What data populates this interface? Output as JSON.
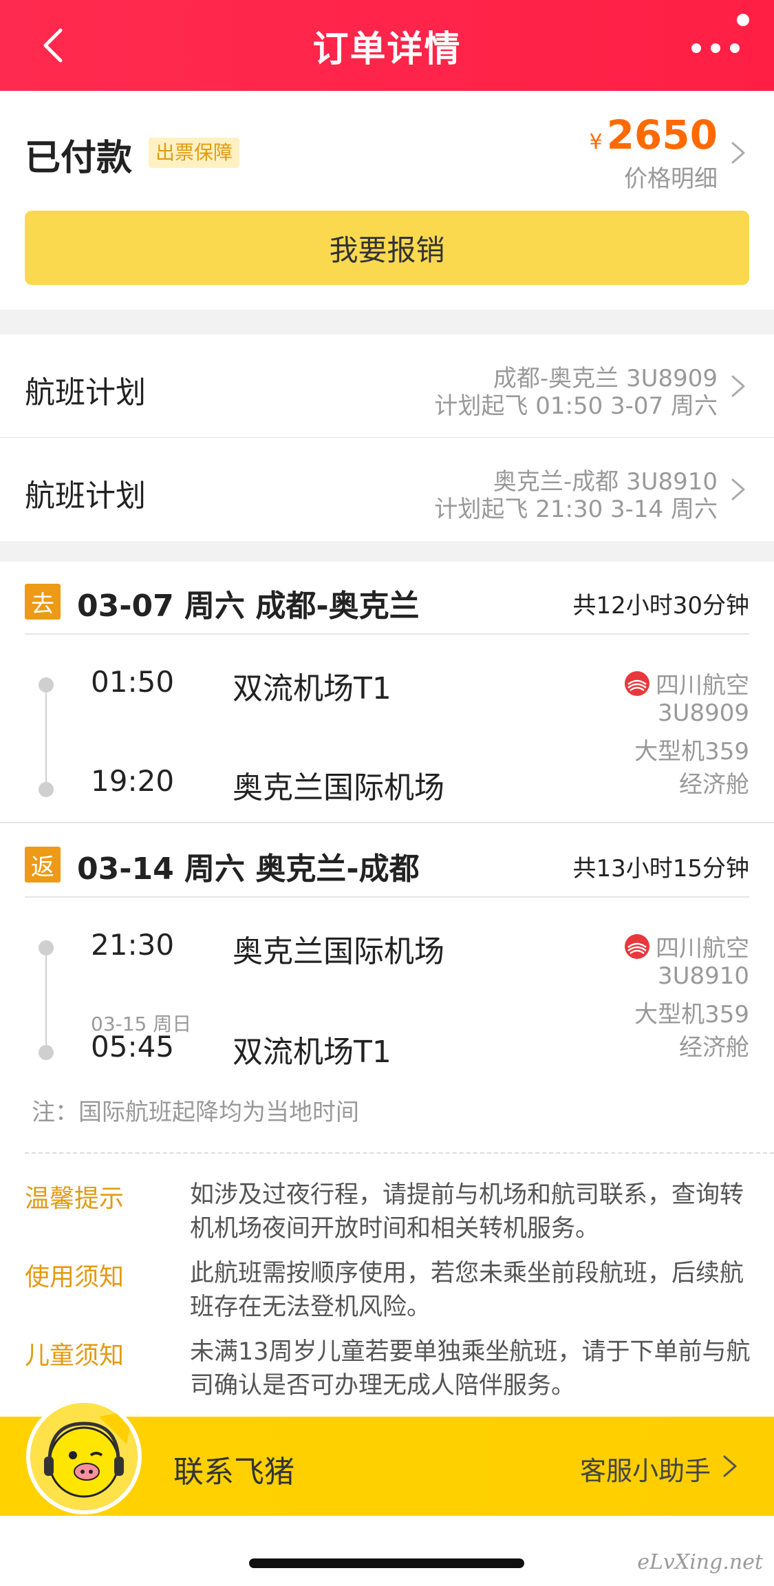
{
  "header": {
    "title": "订单详情"
  },
  "payment": {
    "status": "已付款",
    "badge": "出票保障",
    "currency": "¥",
    "amount": "2650",
    "detail_label": "价格明细",
    "reimburse_button": "我要报销"
  },
  "plans": [
    {
      "label": "航班计划",
      "route": "成都-奥克兰 3U8909",
      "departure": "计划起飞 01:50 3-07 周六"
    },
    {
      "label": "航班计划",
      "route": "奥克兰-成都 3U8910",
      "departure": "计划起飞 21:30 3-14 周六"
    }
  ],
  "segments": [
    {
      "tag": "去",
      "heading": "03-07 周六 成都-奥克兰",
      "duration": "共12小时30分钟",
      "dep_time": "01:50",
      "dep_airport": "双流机场T1",
      "arr_note": "",
      "arr_time": "19:20",
      "arr_airport": "奥克兰国际机场",
      "airline": "四川航空",
      "flight_no": "3U8909",
      "aircraft": "大型机359",
      "cabin": "经济舱"
    },
    {
      "tag": "返",
      "heading": "03-14 周六 奥克兰-成都",
      "duration": "共13小时15分钟",
      "dep_time": "21:30",
      "dep_airport": "奥克兰国际机场",
      "arr_note": "03-15 周日",
      "arr_time": "05:45",
      "arr_airport": "双流机场T1",
      "airline": "四川航空",
      "flight_no": "3U8910",
      "aircraft": "大型机359",
      "cabin": "经济舱"
    }
  ],
  "note": "注：国际航班起降均为当地时间",
  "tips": [
    {
      "key": "温馨提示",
      "text": "如涉及过夜行程，请提前与机场和航司联系，查询转机机场夜间开放时间和相关转机服务。"
    },
    {
      "key": "使用须知",
      "text": "此航班需按顺序使用，若您未乘坐前段航班，后续航班存在无法登机风险。"
    },
    {
      "key": "儿童须知",
      "text": "未满13周岁儿童若要单独乘坐航班，请于下单前与航司确认是否可办理无成人陪伴服务。"
    }
  ],
  "bottom_bar": {
    "contact": "联系飞猪",
    "assistant": "客服小助手"
  },
  "watermark": "eLvXing.net",
  "colors": {
    "header": "#ff2a4f",
    "accent": "#fbd94f",
    "price": "#ff6a00",
    "tag": "#ed9a16",
    "tip_key": "#e29a12"
  }
}
